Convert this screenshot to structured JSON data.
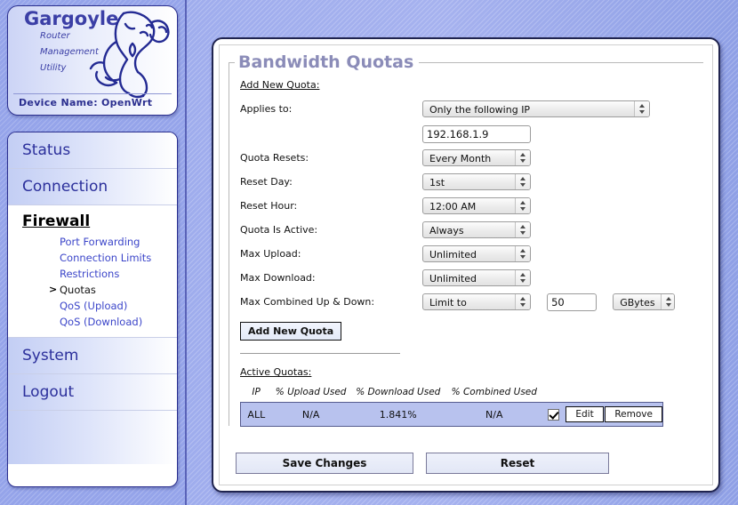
{
  "brand": {
    "title": "Gargoyle",
    "sub1": "Router",
    "sub2": "Management",
    "sub3": "Utility",
    "device_name": "Device Name: OpenWrt",
    "logo_icon": "gargoyle-logo-icon",
    "accent_color": "#2b2f8f"
  },
  "sidebar": {
    "sections": [
      {
        "label": "Status",
        "active": false,
        "items": []
      },
      {
        "label": "Connection",
        "active": false,
        "items": []
      },
      {
        "label": "Firewall",
        "active": true,
        "items": [
          {
            "label": "Port Forwarding",
            "selected": false
          },
          {
            "label": "Connection Limits",
            "selected": false
          },
          {
            "label": "Restrictions",
            "selected": false
          },
          {
            "label": "Quotas",
            "selected": true
          },
          {
            "label": "QoS (Upload)",
            "selected": false
          },
          {
            "label": "QoS (Download)",
            "selected": false
          }
        ]
      },
      {
        "label": "System",
        "active": false,
        "items": []
      },
      {
        "label": "Logout",
        "active": false,
        "items": []
      }
    ]
  },
  "main": {
    "legend": "Bandwidth Quotas",
    "add_new_label": "Add New Quota:",
    "fields": {
      "applies_to": {
        "label": "Applies to:",
        "value": "Only the following IP",
        "ip_value": "192.168.1.9",
        "ip_placeholder": ""
      },
      "quota_resets": {
        "label": "Quota Resets:",
        "value": "Every Month"
      },
      "reset_day": {
        "label": "Reset Day:",
        "value": "1st"
      },
      "reset_hour": {
        "label": "Reset Hour:",
        "value": "12:00 AM"
      },
      "quota_active": {
        "label": "Quota Is Active:",
        "value": "Always"
      },
      "max_upload": {
        "label": "Max Upload:",
        "value": "Unlimited"
      },
      "max_download": {
        "label": "Max Download:",
        "value": "Unlimited"
      },
      "max_combined": {
        "label": "Max Combined Up & Down:",
        "value": "Limit to",
        "amount": "50",
        "unit": "GBytes"
      }
    },
    "add_quota_button": "Add New  Quota",
    "active_quotas": {
      "title": "Active Quotas:",
      "columns": [
        "IP",
        "% Upload Used",
        "% Download Used",
        "% Combined Used"
      ],
      "rows": [
        {
          "ip": "ALL",
          "upload_used": "N/A",
          "download_used": "1.841%",
          "combined_used": "N/A",
          "enabled": true,
          "edit_label": "Edit",
          "remove_label": "Remove"
        }
      ]
    },
    "save_button": "Save Changes",
    "reset_button": "Reset"
  }
}
